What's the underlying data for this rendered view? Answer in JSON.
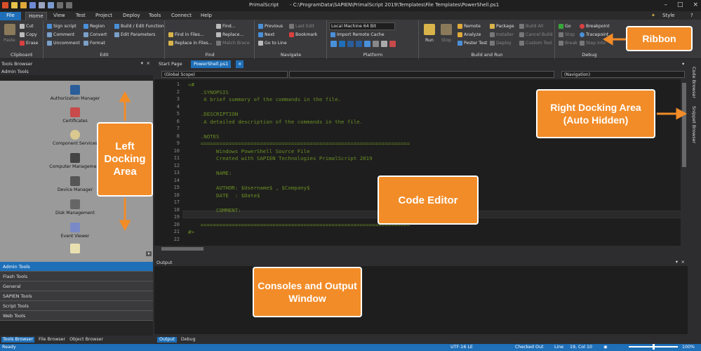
{
  "title_bar": {
    "app_name": "PrimalScript",
    "path": "- C:\\ProgramData\\SAPIEN\\PrimalScript 2019\\Templates\\File Templates\\PowerShell.ps1",
    "style_label": "Style"
  },
  "menu": {
    "tabs": [
      "File",
      "Home",
      "View",
      "Test",
      "Project",
      "Deploy",
      "Tools",
      "Connect",
      "Help"
    ],
    "active": "Home"
  },
  "ribbon": {
    "clipboard": {
      "label": "Clipboard",
      "paste": "Paste",
      "cut": "Cut",
      "copy": "Copy",
      "erase": "Erase"
    },
    "edit": {
      "label": "Edit",
      "sign_script": "Sign script",
      "region": "Region",
      "build_edit_function": "Build / Edit Function",
      "comment": "Comment",
      "convert": "Convert",
      "edit_parameters": "Edit Parameters",
      "uncomment": "Uncomment",
      "format": "Format"
    },
    "find": {
      "label": "Find",
      "find_in_files": "Find in Files...",
      "find": "Find...",
      "replace_in_files": "Replace in Files...",
      "replace": "Replace...",
      "match_brace": "Match Brace"
    },
    "navigate": {
      "label": "Navigate",
      "previous": "Previous",
      "last_edit": "Last Edit",
      "next": "Next",
      "bookmark": "Bookmark",
      "go_to_line": "Go to Line"
    },
    "platform": {
      "label": "Platform",
      "machine": "Local Machine 64 Bit",
      "import_remote_cache": "Import Remote Cache"
    },
    "build_run": {
      "label": "Build and Run",
      "run": "Run",
      "stop": "Stop",
      "remote": "Remote",
      "analyze": "Analyze",
      "pester_test": "Pester Test",
      "package": "Package",
      "installer": "Installer",
      "deploy": "Deploy",
      "build_all": "Build All",
      "cancel_build": "Cancel Build",
      "custom_tool": "Custom Tool"
    },
    "debug": {
      "label": "Debug",
      "go": "Go",
      "stop": "Stop",
      "break": "Break",
      "breakpoint": "Breakpoint",
      "tracepoint": "Tracepoint",
      "step_into": "Step Into"
    }
  },
  "left_panel": {
    "header": "Tools Browser",
    "section": "Admin Tools",
    "tools": [
      "Authorization Manager",
      "Certificates",
      "Component Services",
      "Computer Management",
      "Device Manager",
      "Disk Management",
      "Event Viewer"
    ],
    "categories": [
      "Admin Tools",
      "Flash Tools",
      "General",
      "SAPIEN Tools",
      "Script Tools",
      "Web Tools"
    ],
    "bottom_tabs": [
      "Tools Browser",
      "File Browser",
      "Object Browser"
    ]
  },
  "documents": {
    "tabs": [
      "Start Page",
      "PowerShell.ps1"
    ],
    "active": "PowerShell.ps1",
    "scope": "(Global Scope)",
    "navigation": "(Navigation)"
  },
  "code": {
    "line_numbers": [
      "1",
      "2",
      "3",
      "4",
      "5",
      "6",
      "7",
      "8",
      "9",
      "10",
      "11",
      "12",
      "13",
      "14",
      "15",
      "16",
      "17",
      "18",
      "19",
      "20",
      "21",
      "22"
    ],
    "lines": [
      "<#",
      "    .SYNOPSIS",
      "     A brief summary of the commands in the file.",
      "",
      "    .DESCRIPTION",
      "     A detailed description of the commands in the file.",
      "",
      "    .NOTES",
      "    ===================================================================",
      "         Windows PowerShell Source File",
      "         Created with SAPIEN Technologies PrimalScript 2019",
      "",
      "         NAME:",
      "",
      "         AUTHOR: $Username$ , $Company$",
      "         DATE  : $Date$",
      "",
      "         COMMENT:",
      "",
      "    ===================================================================",
      "#>",
      ""
    ]
  },
  "right_dock": {
    "items": [
      "Code Browser",
      "Snippet Browser"
    ]
  },
  "output": {
    "header": "Output",
    "tabs": [
      "Output",
      "Debug"
    ]
  },
  "status_bar": {
    "ready": "Ready",
    "encoding": "UTF-16 LE",
    "checked_out": "Checked Out",
    "line_label": "Line",
    "line_col": "19, Col 10",
    "zoom": "100%"
  },
  "callouts": {
    "ribbon": "Ribbon",
    "left": "Left Docking Area",
    "right": "Right Docking Area (Auto Hidden)",
    "code_editor": "Code Editor",
    "consoles": "Consoles and Output Window"
  },
  "colors": {
    "accent": "#1e6fb8",
    "callout": "#f28c28",
    "comment_text": "#6b8e23"
  }
}
